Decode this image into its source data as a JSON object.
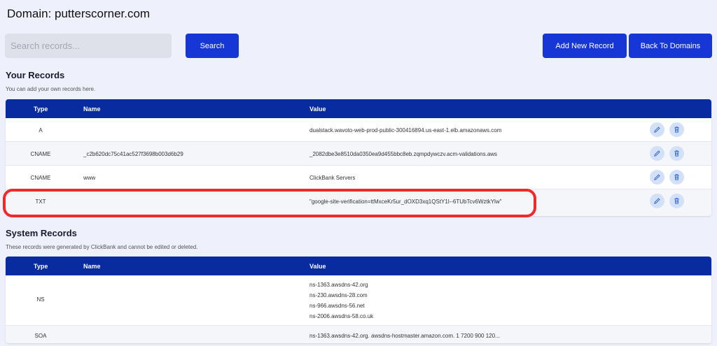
{
  "header": {
    "title": "Domain: putterscorner.com"
  },
  "search": {
    "placeholder": "Search records...",
    "value": "",
    "button_label": "Search"
  },
  "actions": {
    "add_label": "Add New Record",
    "back_label": "Back To Domains"
  },
  "your_records": {
    "title": "Your Records",
    "subtitle": "You can add your own records here.",
    "columns": {
      "type": "Type",
      "name": "Name",
      "value": "Value"
    },
    "rows": [
      {
        "type": "A",
        "name": "",
        "value": "dualstack.wavoto-web-prod-public-300416894.us-east-1.elb.amazonaws.com"
      },
      {
        "type": "CNAME",
        "name": "_c2b620dc75c41ac527f3698b003d6b29",
        "value": "_2082dbe3e8510da0350ea9d455bbc8eb.zqmpdywczv.acm-validations.aws"
      },
      {
        "type": "CNAME",
        "name": "www",
        "value": "ClickBank Servers"
      },
      {
        "type": "TXT",
        "name": "",
        "value": "\"google-site-verification=ttMxceKr5ur_dOXD3xq1QStY1l--6TUbTcv6WztkYlw\""
      }
    ]
  },
  "system_records": {
    "title": "System Records",
    "subtitle": "These records were generated by ClickBank and cannot be edited or deleted.",
    "columns": {
      "type": "Type",
      "name": "Name",
      "value": "Value"
    },
    "rows": [
      {
        "type": "NS",
        "name": "",
        "values": [
          "ns-1363.awsdns-42.org",
          "ns-230.awsdns-28.com",
          "ns-966.awsdns-56.net",
          "ns-2006.awsdns-58.co.uk"
        ]
      },
      {
        "type": "SOA",
        "name": "",
        "value": "ns-1363.awsdns-42.org. awsdns-hostmaster.amazon.com. 1 7200 900 120..."
      }
    ]
  },
  "icons": {
    "edit": "pencil-icon",
    "delete": "trash-icon"
  },
  "colors": {
    "primary": "#1637d6",
    "table_header": "#082ca0",
    "highlight": "#ee2a2a",
    "icon_bg": "#d3e1f8"
  }
}
